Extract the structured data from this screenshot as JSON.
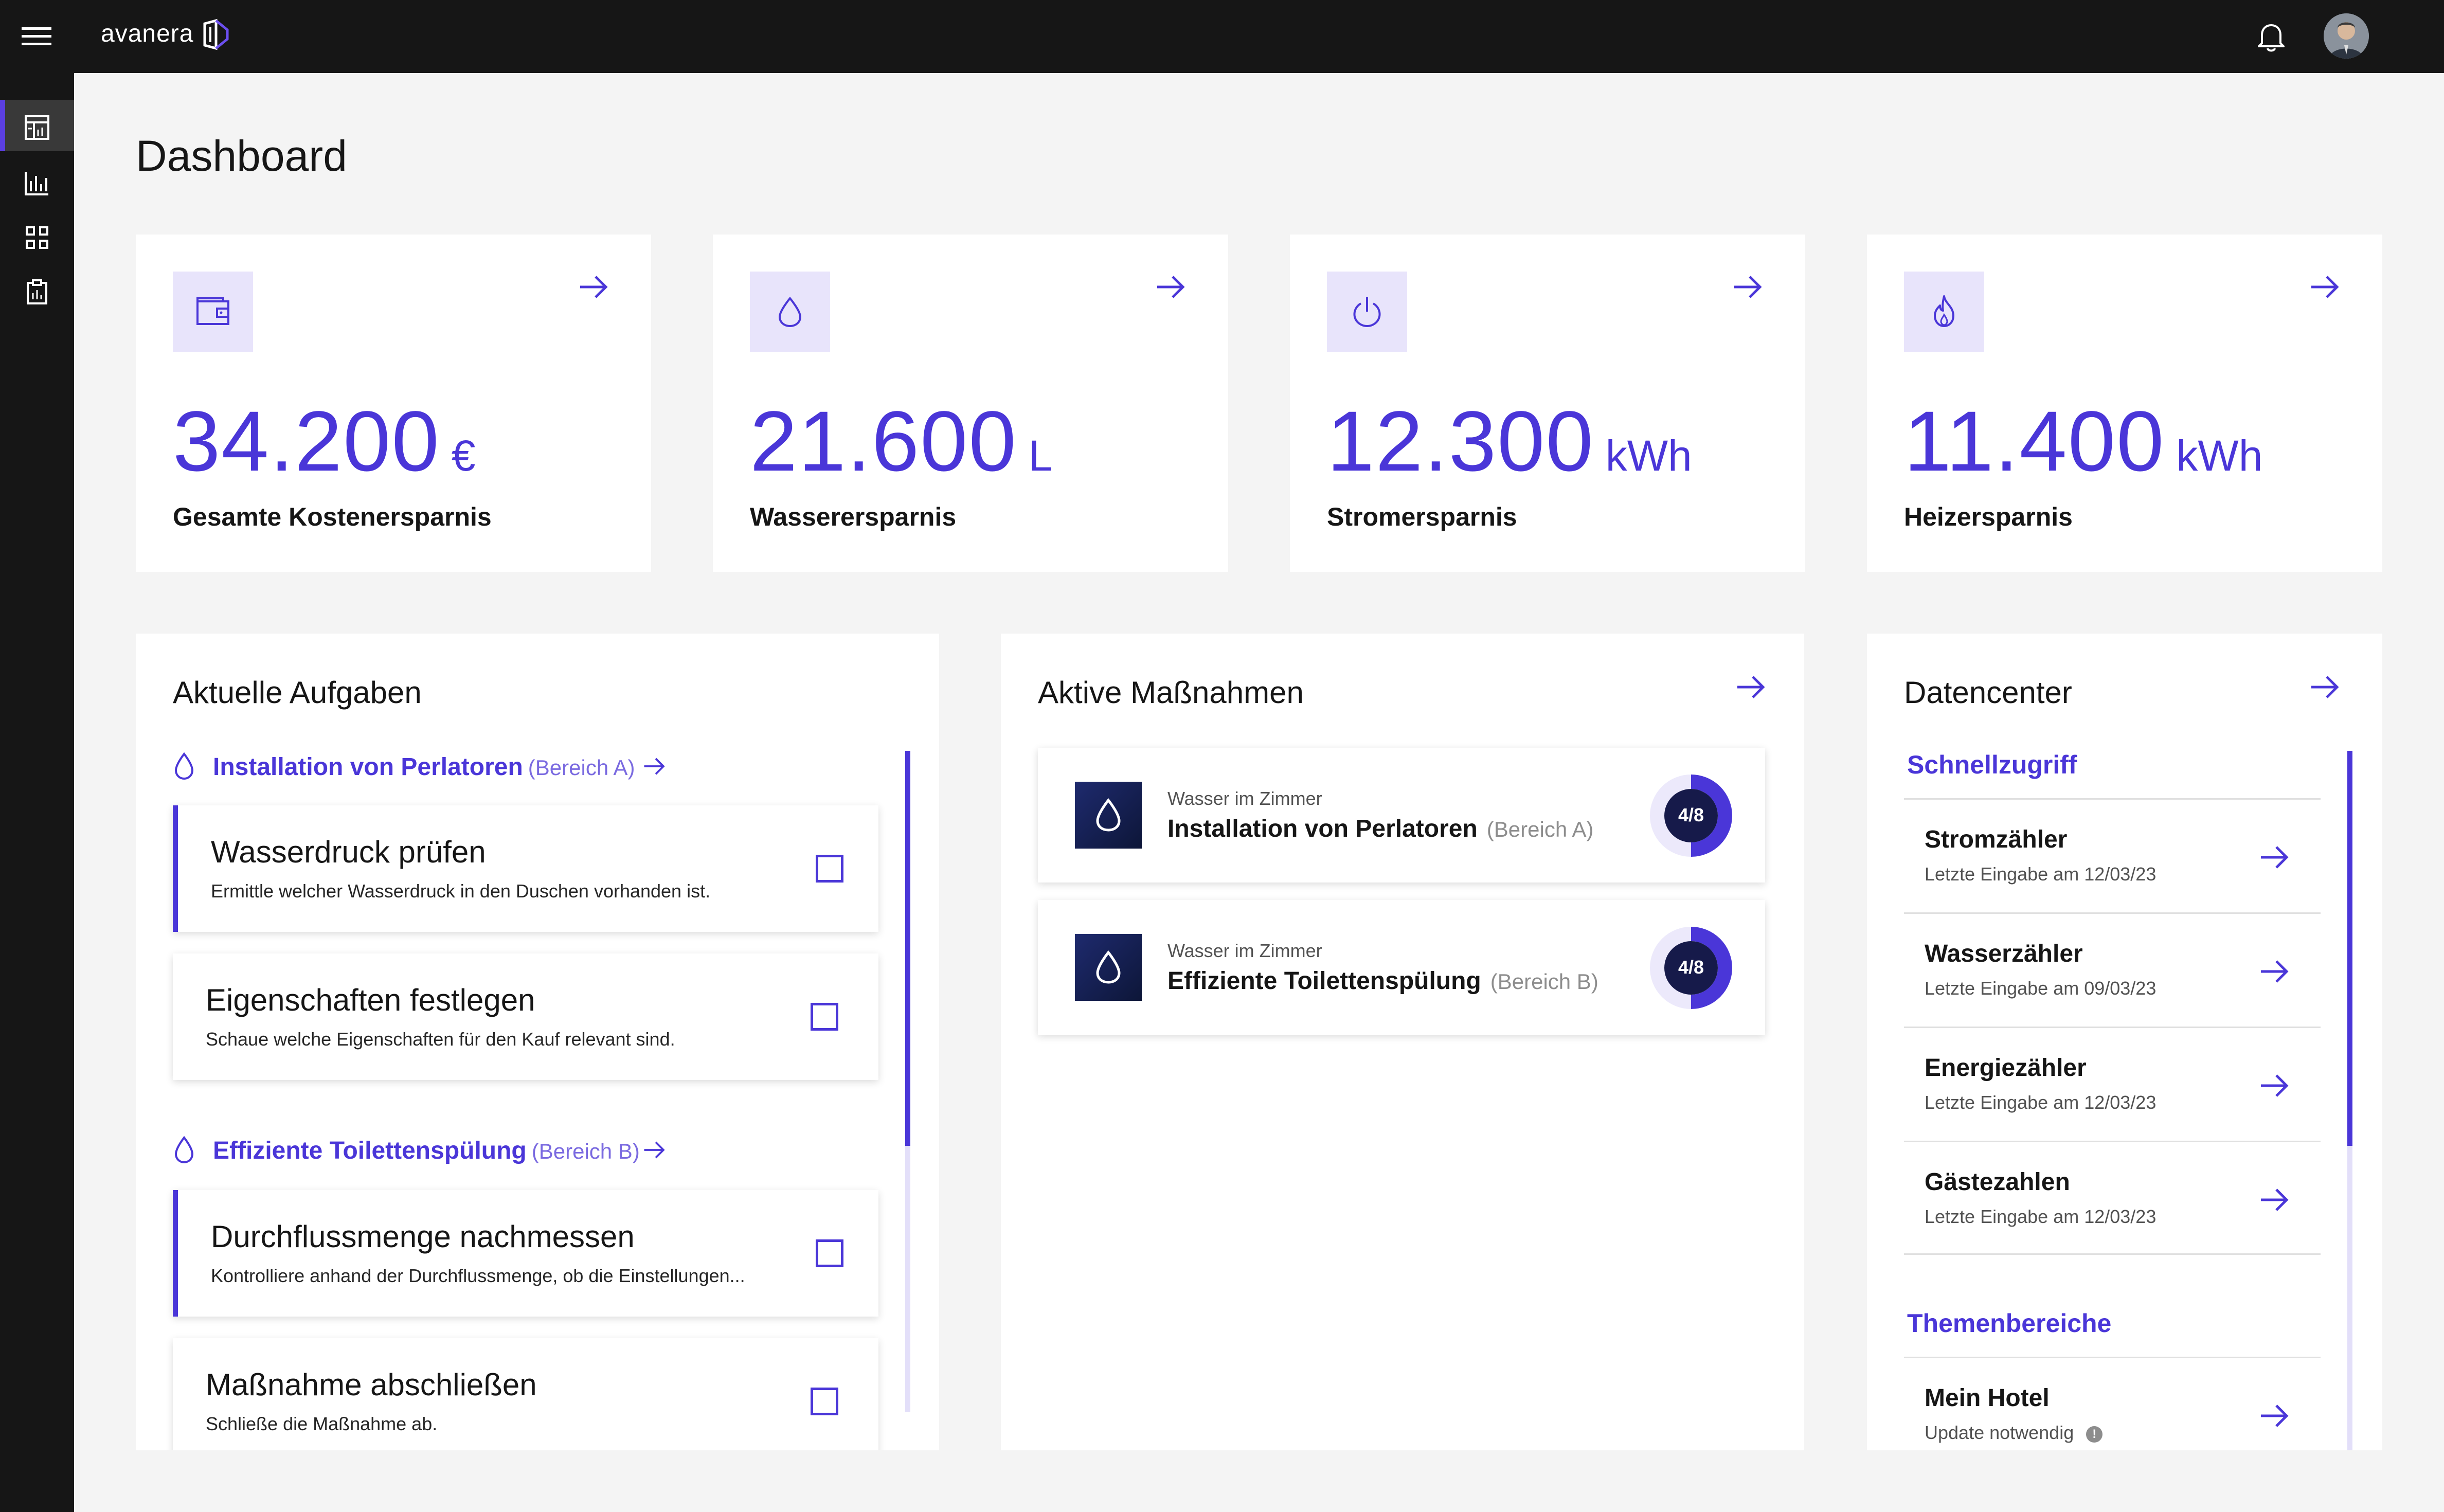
{
  "app": {
    "logo_text": "avanera"
  },
  "page": {
    "title": "Dashboard"
  },
  "stats": [
    {
      "value": "34.200",
      "unit": "€",
      "label": "Gesamte Kostenersparnis",
      "icon": "wallet-icon"
    },
    {
      "value": "21.600",
      "unit": "L",
      "label": "Wasserersparnis",
      "icon": "water-drop-icon"
    },
    {
      "value": "12.300",
      "unit": "kWh",
      "label": "Stromersparnis",
      "icon": "power-icon"
    },
    {
      "value": "11.400",
      "unit": "kWh",
      "label": "Heizersparnis",
      "icon": "flame-icon"
    }
  ],
  "tasks_panel": {
    "title": "Aktuelle Aufgaben",
    "groups": [
      {
        "name": "Installation von Perlatoren",
        "area": "(Bereich A)",
        "tasks": [
          {
            "title": "Wasserdruck prüfen",
            "description": "Ermittle welcher Wasserdruck in den Duschen vorhanden ist.",
            "checked": false
          },
          {
            "title": "Eigenschaften festlegen",
            "description": "Schaue welche Eigenschaften für den Kauf relevant sind.",
            "checked": false
          }
        ]
      },
      {
        "name": "Effiziente Toilettenspülung",
        "area": "(Bereich B)",
        "tasks": [
          {
            "title": "Durchflussmenge nachmessen",
            "description": "Kontrolliere anhand der Durchflussmenge, ob die Einstellungen...",
            "checked": false
          },
          {
            "title": "Maßnahme abschließen",
            "description": "Schließe die Maßnahme ab.",
            "checked": false
          }
        ]
      }
    ]
  },
  "measures_panel": {
    "title": "Aktive Maßnahmen",
    "items": [
      {
        "category": "Wasser im Zimmer",
        "title": "Installation von Perlatoren",
        "area": "(Bereich A)",
        "progress": "4/8",
        "done": 4,
        "total": 8
      },
      {
        "category": "Wasser im Zimmer",
        "title": "Effiziente Toilettenspülung",
        "area": "(Bereich B)",
        "progress": "4/8",
        "done": 4,
        "total": 8
      }
    ]
  },
  "datacenter_panel": {
    "title": "Datencenter",
    "quick_access_title": "Schnellzugriff",
    "quick_access": [
      {
        "name": "Stromzähler",
        "last_entry": "Letzte Eingabe am 12/03/23"
      },
      {
        "name": "Wasserzähler",
        "last_entry": "Letzte Eingabe am 09/03/23"
      },
      {
        "name": "Energiezähler",
        "last_entry": "Letzte Eingabe am 12/03/23"
      },
      {
        "name": "Gästezahlen",
        "last_entry": "Letzte Eingabe am 12/03/23"
      }
    ],
    "topics_title": "Themenbereiche",
    "topics": [
      {
        "name": "Mein Hotel",
        "status": "Update notwendig"
      }
    ]
  },
  "colors": {
    "accent": "#4a36d8",
    "accent_light": "#e8e4fb",
    "topbar": "#161616",
    "background": "#f4f4f4"
  }
}
